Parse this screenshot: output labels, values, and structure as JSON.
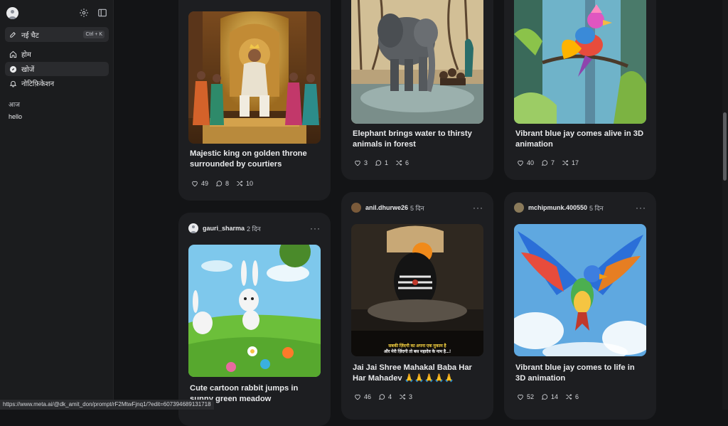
{
  "sidebar": {
    "new_chat_label": "नई चैट",
    "new_chat_shortcut": "Ctrl + K",
    "nav": [
      {
        "label": "होम",
        "icon": "home-icon"
      },
      {
        "label": "खोजें",
        "icon": "compass-icon"
      },
      {
        "label": "नोटिफ़िकेशन",
        "icon": "bell-icon"
      }
    ],
    "section_today": "आज",
    "history": [
      "hello"
    ]
  },
  "status_url": "https://www.meta.ai/@dk_amit_don/prompt/rF2MtwFjnq1/?edit=607394689131718",
  "cards": [
    {
      "title": "Majestic king on golden throne surrounded by courtiers",
      "likes": "49",
      "comments": "8",
      "remixes": "10"
    },
    {
      "title": "Elephant brings water to thirsty animals in forest",
      "likes": "3",
      "comments": "1",
      "remixes": "6"
    },
    {
      "title": "Vibrant blue jay comes alive in 3D animation",
      "likes": "40",
      "comments": "7",
      "remixes": "17"
    },
    {
      "user": "gauri_sharma",
      "time": "2 दिन",
      "title": "Cute cartoon rabbit jumps in sunny green meadow"
    },
    {
      "user": "anil.dhurwe26",
      "time": "5 दिन",
      "title": "Jai Jai Shree Mahakal Baba Har Har Mahadev 🙏🙏🙏🙏🙏",
      "caption_line1": "सबकी ज़िंदगी का अपना एक मुकाम है",
      "caption_line2": "और मेरी ज़िंदगी तो बस महादेव के नाम है...!",
      "likes": "46",
      "comments": "4",
      "remixes": "3"
    },
    {
      "user": "mchipmunk.400550",
      "time": "5 दिन",
      "title": "Vibrant blue jay comes to life in 3D animation",
      "likes": "52",
      "comments": "14",
      "remixes": "6"
    }
  ],
  "colors": {
    "background": "#131416",
    "sidebar": "#1b1c1e",
    "card": "#1d1e21"
  }
}
